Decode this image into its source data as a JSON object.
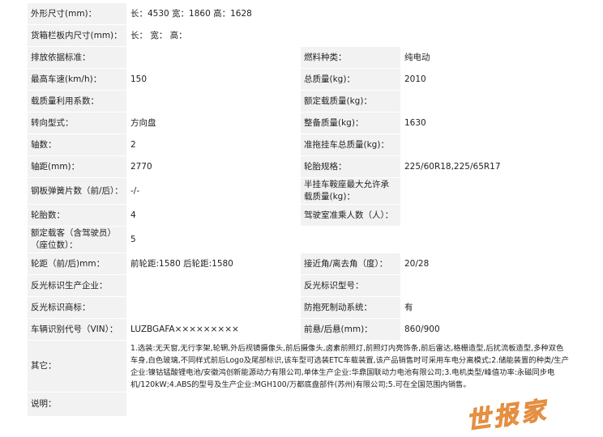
{
  "rows": {
    "dims": {
      "label": "外形尺寸(mm)：",
      "value": "长：4530 宽：1860 高：1628"
    },
    "cargo": {
      "label": "货箱栏板内尺寸(mm)：",
      "value": "长：  宽：  高："
    },
    "emission": {
      "label": "排放依据标准：",
      "value": "",
      "label2": "燃料种类：",
      "value2": "纯电动"
    },
    "speed": {
      "label": "最高车速(km/h)：",
      "value": "150",
      "label2": "总质量(kg)：",
      "value2": "2010"
    },
    "load_util": {
      "label": "载质量利用系数：",
      "value": "",
      "label2": "额定载质量(kg)：",
      "value2": ""
    },
    "steering": {
      "label": "转向型式：",
      "value": "方向盘",
      "label2": "整备质量(kg)：",
      "value2": "1630"
    },
    "axles": {
      "label": "轴数：",
      "value": "2",
      "label2": "准拖挂车总质量(kg)：",
      "value2": ""
    },
    "wheelbase": {
      "label": "轴距(mm)：",
      "value": "2770",
      "label2": "轮胎规格：",
      "value2": "225/60R18,225/65R17"
    },
    "springs": {
      "label": "钢板弹簧片数（前/后）：",
      "value": "-/-",
      "label2": "半挂车鞍座最大允许承载质量(kg)：",
      "value2": ""
    },
    "tires": {
      "label": "轮胎数：",
      "value": "4",
      "label2": "驾驶室准乘人数（人）：",
      "value2": ""
    },
    "seats": {
      "label": "额定载客（含驾驶员）（座位数）：",
      "value": "5"
    },
    "track": {
      "label": "轮距（前/后)mm：",
      "value": "前轮距:1580 后轮距:1580",
      "label2": "接近角/离去角（度）：",
      "value2": "20/28"
    },
    "reflector_maker": {
      "label": "反光标识生产企业：",
      "value": "",
      "label2": "反光标识型号：",
      "value2": ""
    },
    "reflector_brand": {
      "label": "反光标识商标：",
      "value": "",
      "label2": "防抱死制动系统：",
      "value2": "有"
    },
    "vin": {
      "label": "车辆识别代号（VIN）：",
      "value": "LUZBGAFA×××××××××",
      "label2": "前悬/后悬(mm)：",
      "value2": "860/900"
    },
    "other": {
      "label": "其它：",
      "value": "1.选装:无天窗,无行李架,轮辋,外后视镜摄像头,前后摄像头,卤素前照灯,前照灯内亮饰条,前后雷达,格栅造型,后扰流板造型,多种双色车身,白色玻璃,不同样式前后Logo及尾部标识,该车型可选装ETC车载装置,该产品销售时可采用车电分离模式;2.储能装置的种类/生产企业:镍钴锰酸锂电池/安徽鸿创新能源动力有限公司,单体生产企业:华鼎国联动力电池有限公司;3.电机类型/峰值功率:永磁同步电机/120kW;4.ABS的型号及生产企业:MGH100/万都底盘部件(苏州)有限公司;5.可在全国范围内销售。"
    },
    "note": {
      "label": "说明：",
      "value": ""
    }
  },
  "watermark": "世报家"
}
